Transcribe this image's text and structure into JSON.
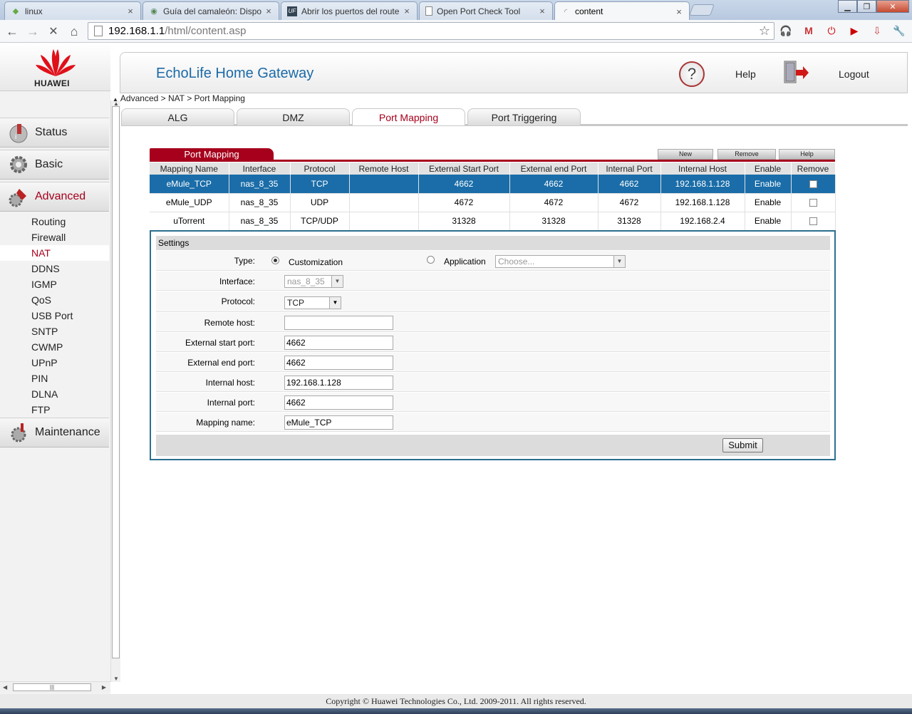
{
  "browser": {
    "tabs": [
      {
        "label": "linux",
        "icon": "linux-icon"
      },
      {
        "label": "Guía del camaleón: Dispo",
        "icon": "chameleon-icon"
      },
      {
        "label": "Abrir los puertos del route",
        "icon": "uf-icon"
      },
      {
        "label": "Open Port Check Tool",
        "icon": "page-icon"
      },
      {
        "label": "content",
        "icon": "loading-icon"
      }
    ],
    "url_host": "192.168.1.1",
    "url_path": "/html/content.asp"
  },
  "header": {
    "logo_text": "HUAWEI",
    "app_title": "EchoLife Home Gateway",
    "help_label": "Help",
    "logout_label": "Logout"
  },
  "sidebar": {
    "sections": [
      {
        "label": "Status"
      },
      {
        "label": "Basic"
      },
      {
        "label": "Advanced"
      },
      {
        "label": "Maintenance"
      }
    ],
    "subitems": [
      "Routing",
      "Firewall",
      "NAT",
      "DDNS",
      "IGMP",
      "QoS",
      "USB Port",
      "SNTP",
      "CWMP",
      "UPnP",
      "PIN",
      "DLNA",
      "FTP"
    ],
    "active_subitem": "NAT"
  },
  "breadcrumb": "Advanced > NAT > Port Mapping",
  "content_tabs": [
    "ALG",
    "DMZ",
    "Port Mapping",
    "Port Triggering"
  ],
  "port_mapping": {
    "title": "Port Mapping",
    "buttons": {
      "new": "New",
      "remove": "Remove",
      "help": "Help"
    },
    "columns": [
      "Mapping Name",
      "Interface",
      "Protocol",
      "Remote Host",
      "External Start Port",
      "External end Port",
      "Internal Port",
      "Internal Host",
      "Enable",
      "Remove"
    ],
    "rows": [
      {
        "name": "eMule_TCP",
        "interface": "nas_8_35",
        "protocol": "TCP",
        "remote_host": "",
        "ext_start": "4662",
        "ext_end": "4662",
        "int_port": "4662",
        "int_host": "192.168.1.128",
        "enable": "Enable"
      },
      {
        "name": "eMule_UDP",
        "interface": "nas_8_35",
        "protocol": "UDP",
        "remote_host": "",
        "ext_start": "4672",
        "ext_end": "4672",
        "int_port": "4672",
        "int_host": "192.168.1.128",
        "enable": "Enable"
      },
      {
        "name": "uTorrent",
        "interface": "nas_8_35",
        "protocol": "TCP/UDP",
        "remote_host": "",
        "ext_start": "31328",
        "ext_end": "31328",
        "int_port": "31328",
        "int_host": "192.168.2.4",
        "enable": "Enable"
      }
    ]
  },
  "settings": {
    "title": "Settings",
    "type_label": "Type:",
    "type_customization": "Customization",
    "type_application": "Application",
    "application_select": "Choose...",
    "interface_label": "Interface:",
    "interface_value": "nas_8_35",
    "protocol_label": "Protocol:",
    "protocol_value": "TCP",
    "remote_host_label": "Remote host:",
    "remote_host_value": "",
    "ext_start_label": "External start port:",
    "ext_start_value": "4662",
    "ext_end_label": "External end port:",
    "ext_end_value": "4662",
    "internal_host_label": "Internal host:",
    "internal_host_value": "192.168.1.128",
    "internal_port_label": "Internal port:",
    "internal_port_value": "4662",
    "mapping_name_label": "Mapping name:",
    "mapping_name_value": "eMule_TCP",
    "submit_label": "Submit"
  },
  "footer": {
    "copyright": "Copyright © Huawei Technologies Co., Ltd.  2009-2011. All rights reserved."
  },
  "colors": {
    "brand_red": "#a6001c",
    "title_blue": "#1b6aa8",
    "selected_row": "#1a6da8"
  }
}
